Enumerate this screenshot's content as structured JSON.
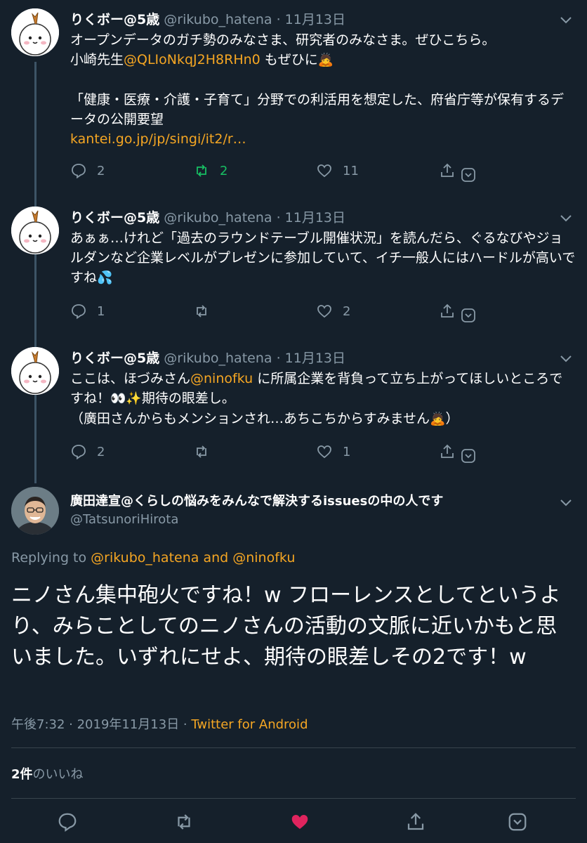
{
  "tweets": [
    {
      "author": "りくボー@5歳",
      "handle": "@rikubo_hatena",
      "dot": "·",
      "date": "11月13日",
      "line1": "オープンデータのガチ勢のみなさま、研究者のみなさま。ぜひこちら。",
      "line2a": "小崎先生",
      "mention": "@QLIoNkqJ2H8RHn0",
      "line2b": " もぜひに",
      "emoji": "🙇",
      "line3": "「健康・医療・介護・子育て」分野での利活用を想定した、府省庁等が保有するデータの公開要望",
      "link": "kantei.go.jp/jp/singi/it2/r…",
      "replies": "2",
      "retweets": "2",
      "likes": "11"
    },
    {
      "author": "りくボー@5歳",
      "handle": "@rikubo_hatena",
      "dot": "·",
      "date": "11月13日",
      "text": "あぁぁ…けれど「過去のラウンドテーブル開催状況」を読んだら、ぐるなびやジョルダンなど企業レベルがプレゼンに参加していて、イチ一般人にはハードルが高いですね",
      "emoji": "💦",
      "replies": "1",
      "retweets": "",
      "likes": "2"
    },
    {
      "author": "りくボー@5歳",
      "handle": "@rikubo_hatena",
      "dot": "·",
      "date": "11月13日",
      "text_a": "ここは、ほづみさん",
      "mention": "@ninofku",
      "text_b": " に所属企業を背負って立ち上がってほしいところですね！",
      "emoji1": "👀✨",
      "text_c": "期待の眼差し。",
      "text_d": "（廣田さんからもメンションされ…あちこちからすみません",
      "emoji2": "🙇",
      "text_e": "）",
      "replies": "2",
      "retweets": "",
      "likes": "1"
    }
  ],
  "main": {
    "author": "廣田達宣@くらしの悩みをみんなで解決するissuesの中の人です",
    "handle": "@TatsunoriHirota",
    "replying_prefix": "Replying to ",
    "replying_to": "@rikubo_hatena and @ninofku",
    "text": "ニノさん集中砲火ですね！w フローレンスとしてというより、みらことしてのニノさんの活動の文脈に近いかもと思いました。いずれにせよ、期待の眼差しその2です！w",
    "time": "午後7:32 · 2019年11月13日 · ",
    "source": "Twitter for Android",
    "likes_count": "2件",
    "likes_label": "のいいね"
  },
  "icons": {
    "reply": "reply-icon",
    "retweet": "retweet-icon",
    "like": "heart-icon",
    "share": "share-icon",
    "more": "chevron-down-icon"
  },
  "colors": {
    "background": "#15202b",
    "accent": "#f5a623",
    "muted": "#8899a6",
    "retweet_green": "#17bf63",
    "like_red": "#e0245e"
  }
}
